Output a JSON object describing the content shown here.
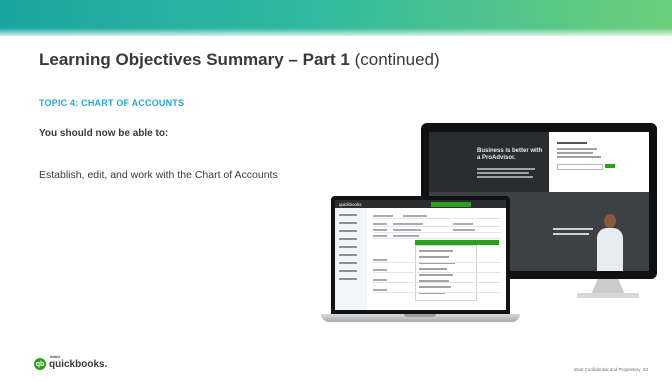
{
  "header": {
    "title_bold": "Learning Objectives Summary – Part 1",
    "title_suffix": "(continued)"
  },
  "content": {
    "topic_heading": "TOPIC 4: CHART OF ACCOUNTS",
    "lead_in": "You should now be able to:",
    "objective": "Establish, edit, and work with the Chart of Accounts"
  },
  "footer": {
    "logo_intuit": "intuit",
    "logo_text": "quickbooks.",
    "confidential": "Intuit Confidential and Proprietary",
    "page_number": "83"
  },
  "devices": {
    "monitor_headline": "Business is better with a ProAdvisor.",
    "laptop_brand": "quickbooks"
  },
  "colors": {
    "accent_teal": "#1aa6a0",
    "accent_green": "#6ccf7a",
    "topic_blue": "#21a9d6",
    "text_dark": "#393a3d",
    "qb_green": "#2ca01c"
  }
}
